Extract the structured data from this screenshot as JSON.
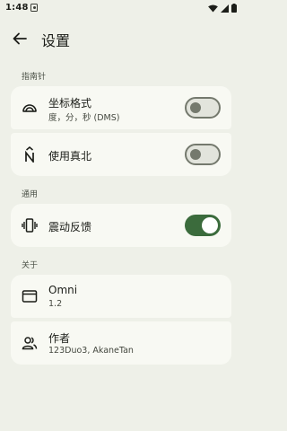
{
  "status_bar": {
    "time": "1:48"
  },
  "app_bar": {
    "title": "设置"
  },
  "sections": {
    "compass": {
      "header": "指南针"
    },
    "general": {
      "header": "通用"
    },
    "about": {
      "header": "关于"
    }
  },
  "settings": {
    "coordinate_format": {
      "title": "坐标格式",
      "subtitle": "度，分，秒 (DMS)",
      "enabled": false,
      "icon": "arc-dashboard-icon"
    },
    "true_north": {
      "title": "使用真北",
      "enabled": false,
      "icon": "north-arrow-icon"
    },
    "haptic_feedback": {
      "title": "震动反馈",
      "enabled": true,
      "icon": "vibration-icon"
    }
  },
  "about": {
    "app": {
      "title": "Omni",
      "subtitle": "1.2",
      "icon": "app-window-icon"
    },
    "authors": {
      "title": "作者",
      "subtitle": "123Duo3, AkaneTan",
      "icon": "people-icon"
    }
  },
  "colors": {
    "accent": "#3b6b3c",
    "background": "#eef0e8",
    "card": "#f8f9f3"
  }
}
